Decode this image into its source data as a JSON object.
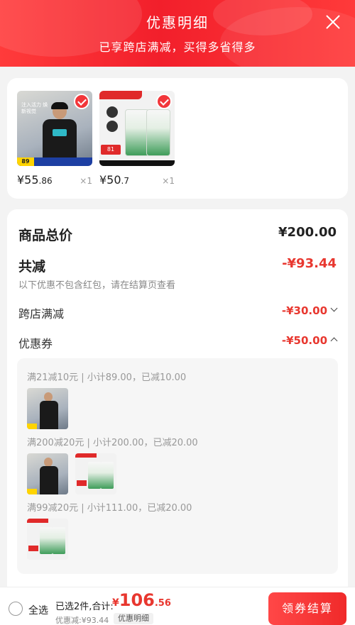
{
  "header": {
    "title": "优惠明细",
    "subtitle": "已享跨店满减，买得多省得多"
  },
  "products": [
    {
      "price_main": "¥55",
      "price_dec": ".86",
      "qty": "×1",
      "image_text": "注入活力 焕新视觉",
      "image_badge": "89"
    },
    {
      "price_main": "¥50",
      "price_dec": ".7",
      "qty": "×1",
      "image_badge": "81"
    }
  ],
  "summary": {
    "total_label": "商品总价",
    "total_value": "¥200.00",
    "discount_label": "共减",
    "discount_value": "-¥93.44",
    "note": "以下优惠不包含红包，请在结算页查看",
    "cross_store_label": "跨店满减",
    "cross_store_value": "-¥30.00",
    "coupon_label": "优惠券",
    "coupon_value": "-¥50.00"
  },
  "coupons": [
    {
      "text": "满21减10元 | 小计89.00，已减10.00"
    },
    {
      "text": "满200减20元 | 小计200.00，已减20.00"
    },
    {
      "text": "满99减20元 | 小计111.00，已减20.00"
    }
  ],
  "bottom": {
    "select_all": "全选",
    "selected_text": "已选2件,合计:",
    "total_currency": "¥",
    "total_int": "106",
    "total_dec": ".56",
    "discount_text": "优惠减:¥93.44",
    "detail_label": "优惠明细",
    "checkout_label": "领券结算"
  },
  "colors": {
    "accent": "#e8372f",
    "header": "#f21f2b"
  }
}
